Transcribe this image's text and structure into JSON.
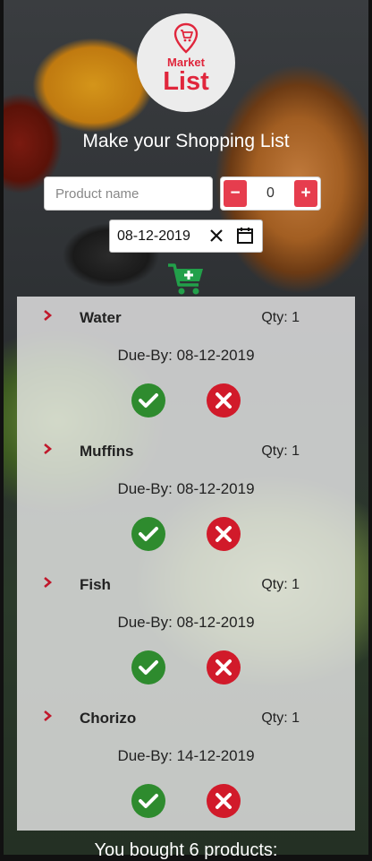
{
  "app": {
    "logo_line1": "Market",
    "logo_line2": "List",
    "heading": "Make your Shopping List"
  },
  "form": {
    "product_placeholder": "Product name",
    "product_value": "",
    "quantity": "0",
    "minus_label": "−",
    "plus_label": "+",
    "date": "08-12-2019"
  },
  "items": [
    {
      "name": "Water",
      "qty": "Qty: 1",
      "due": "Due-By: 08-12-2019"
    },
    {
      "name": "Muffins",
      "qty": "Qty: 1",
      "due": "Due-By: 08-12-2019"
    },
    {
      "name": "Fish",
      "qty": "Qty: 1",
      "due": "Due-By: 08-12-2019"
    },
    {
      "name": "Chorizo",
      "qty": "Qty: 1",
      "due": "Due-By: 14-12-2019"
    }
  ],
  "summary": "You bought 6 products:",
  "colors": {
    "accent_red": "#e63d4e",
    "confirm_green": "#2e8b2e",
    "cart_green": "#22a04a"
  },
  "icons": {
    "logo": "cart-pin-icon",
    "add": "add-to-cart-icon",
    "row_expand": "chevron-right-icon",
    "confirm": "check-circle-icon",
    "remove": "x-circle-icon",
    "date_clear": "close-icon",
    "date_picker": "calendar-icon"
  }
}
